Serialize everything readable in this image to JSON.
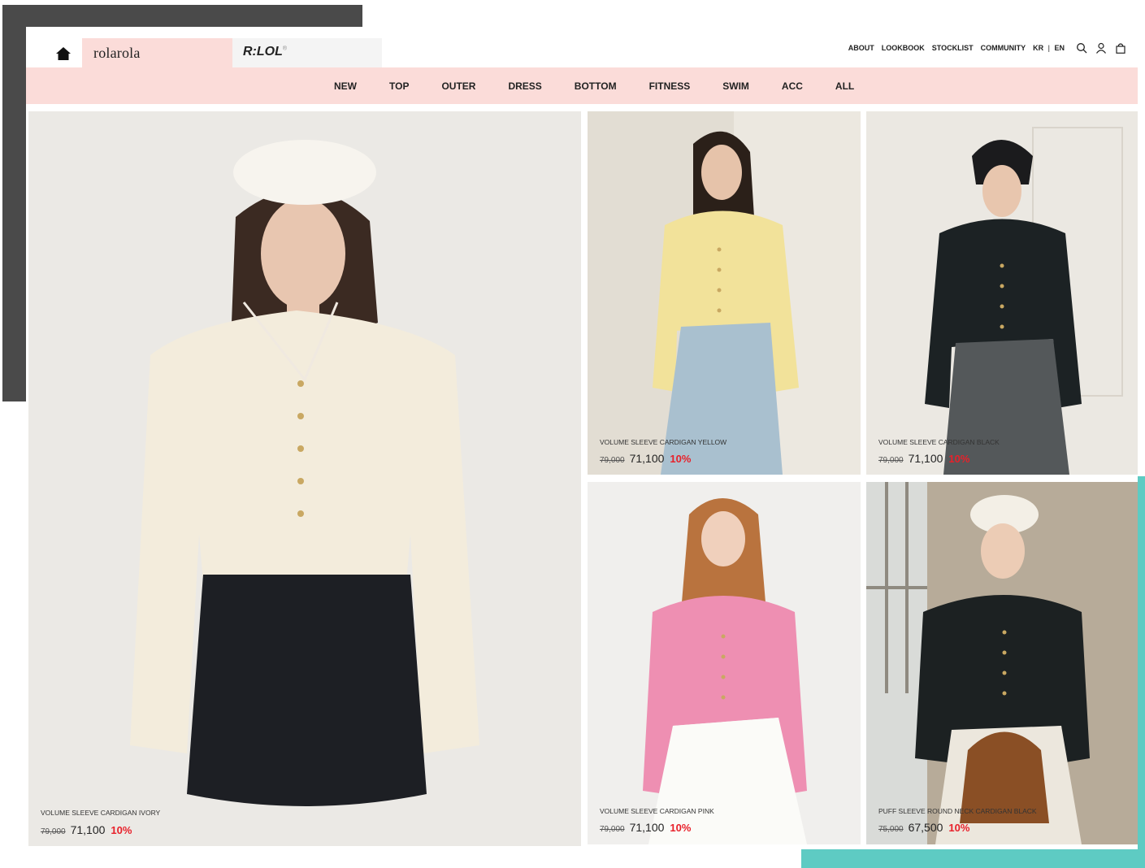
{
  "brand": {
    "primary_tab": "rolarola",
    "secondary_tab": "R:LOL",
    "secondary_mark": "®"
  },
  "utility_nav": {
    "about": "ABOUT",
    "lookbook": "LOOKBOOK",
    "stocklist": "STOCKLIST",
    "community": "COMMUNITY",
    "kr": "KR",
    "sep": "|",
    "en": "EN"
  },
  "icons": [
    "home-icon",
    "search-icon",
    "user-icon",
    "bag-icon"
  ],
  "categories": [
    "NEW",
    "TOP",
    "OUTER",
    "DRESS",
    "BOTTOM",
    "FITNESS",
    "SWIM",
    "ACC",
    "ALL"
  ],
  "products": [
    {
      "name": "VOLUME SLEEVE CARDIGAN IVORY",
      "original_price": "79,000",
      "sale_price": "71,100",
      "discount": "10%"
    },
    {
      "name": "VOLUME SLEEVE CARDIGAN YELLOW",
      "original_price": "79,000",
      "sale_price": "71,100",
      "discount": "10%"
    },
    {
      "name": "VOLUME SLEEVE CARDIGAN BLACK",
      "original_price": "79,000",
      "sale_price": "71,100",
      "discount": "10%"
    },
    {
      "name": "VOLUME SLEEVE CARDIGAN PINK",
      "original_price": "79,000",
      "sale_price": "71,100",
      "discount": "10%"
    },
    {
      "name": "PUFF SLEEVE ROUND NECK CARDIGAN BLACK",
      "original_price": "75,000",
      "sale_price": "67,500",
      "discount": "10%"
    }
  ],
  "colors": {
    "nav_pink": "#fbdcd9",
    "discount_red": "#e8202a",
    "deco_gray": "#4a4a4a",
    "deco_teal": "#5ecbc3"
  }
}
